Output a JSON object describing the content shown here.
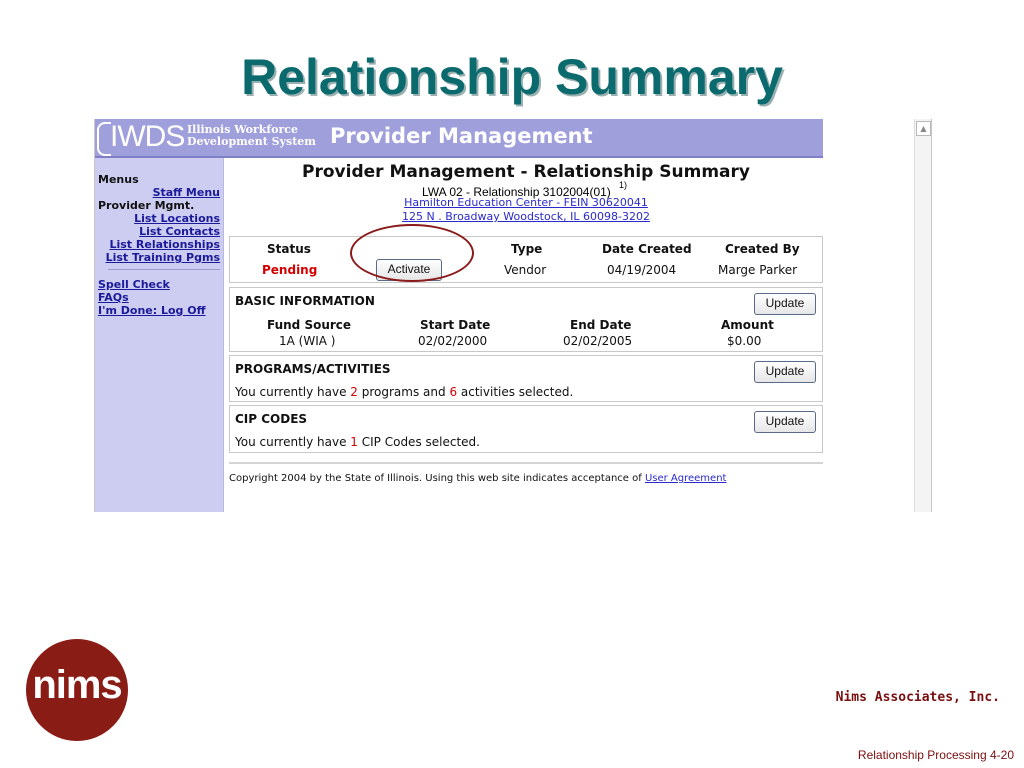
{
  "slide": {
    "title": "Relationship Summary",
    "company": "Nims Associates, Inc.",
    "logo_text": "nims",
    "footer": "Relationship Processing  4-20"
  },
  "banner": {
    "logo": "IWDS",
    "logo_sub_line1": "Illinois Workforce",
    "logo_sub_line2": "Development System",
    "app_title": "Provider Management"
  },
  "nav": {
    "menus_label": "Menus",
    "staff_menu": "Staff Menu",
    "provider_label": "Provider Mgmt.",
    "items": [
      "List Locations",
      "List Contacts",
      "List Relationships",
      "List Training Pgms"
    ],
    "spell_check": "Spell Check",
    "faqs": "FAQs",
    "logoff": "I'm Done: Log Off"
  },
  "page": {
    "heading": "Provider Management - Relationship Summary",
    "overlay": "LWA 02 - Relationship 3102004(01)",
    "overlay_mark": "1)",
    "provider_link": "Hamilton Education Center - FEIN 30620041",
    "address_link": "125 N . Broadway Woodstock, IL 60098-3202"
  },
  "status_panel": {
    "headers": {
      "status": "Status",
      "type": "Type",
      "date_created": "Date Created",
      "created_by": "Created By"
    },
    "values": {
      "status": "Pending",
      "activate": "Activate",
      "type": "Vendor",
      "date_created": "04/19/2004",
      "created_by": "Marge Parker"
    }
  },
  "basic_info": {
    "title": "BASIC INFORMATION",
    "update": "Update",
    "headers": {
      "fund_source": "Fund Source",
      "start_date": "Start Date",
      "end_date": "End Date",
      "amount": "Amount"
    },
    "values": {
      "fund_source": "1A (WIA )",
      "start_date": "02/02/2000",
      "end_date": "02/02/2005",
      "amount": "$0.00"
    }
  },
  "programs": {
    "title": "PROGRAMS/ACTIVITIES",
    "update": "Update",
    "text_a": "You currently have ",
    "programs_count": "2",
    "text_b": " programs and ",
    "activities_count": "6",
    "text_c": " activities selected."
  },
  "cip": {
    "title": "CIP CODES",
    "update": "Update",
    "text_a": "You currently have ",
    "count": "1",
    "text_b": " CIP Codes selected."
  },
  "copyright": {
    "text": "Copyright 2004 by the State of Illinois. Using this web site indicates acceptance of ",
    "link": "User Agreement"
  },
  "colors": {
    "title": "#0b6a6e",
    "banner": "#9f9fdc",
    "nav": "#cdcdf2",
    "pending": "#d40000",
    "annotation": "#8b1a1a",
    "brand": "#8a1c16"
  }
}
